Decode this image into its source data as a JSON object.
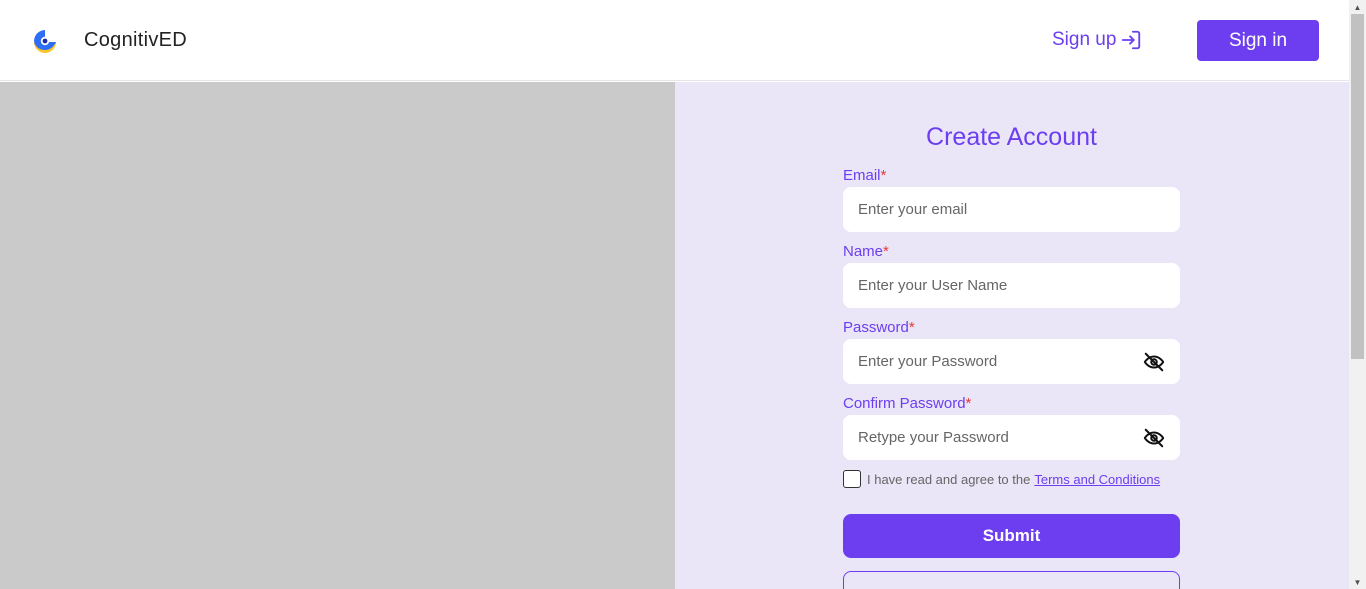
{
  "header": {
    "brand": "CognitivED",
    "signup_label": "Sign up",
    "signin_label": "Sign in"
  },
  "form": {
    "title": "Create Account",
    "required_mark": "*",
    "email": {
      "label": "Email",
      "placeholder": "Enter your email",
      "value": ""
    },
    "name": {
      "label": "Name",
      "placeholder": "Enter your User Name",
      "value": ""
    },
    "password": {
      "label": "Password",
      "placeholder": "Enter your Password",
      "value": ""
    },
    "confirm_password": {
      "label": "Confirm Password",
      "placeholder": "Retype your Password",
      "value": ""
    },
    "terms_text": "I have read and agree to the",
    "terms_link": "Terms and Conditions",
    "terms_checked": false,
    "submit_label": "Submit"
  },
  "colors": {
    "accent": "#6c3ef0",
    "panel_bg": "#ebe6f7",
    "left_panel_bg": "#cacaca",
    "required": "#e53935"
  },
  "icons": {
    "logo": "cognitived-logo-icon",
    "signup": "sign-in-arrow-icon",
    "password_toggle": "eye-off-icon"
  }
}
